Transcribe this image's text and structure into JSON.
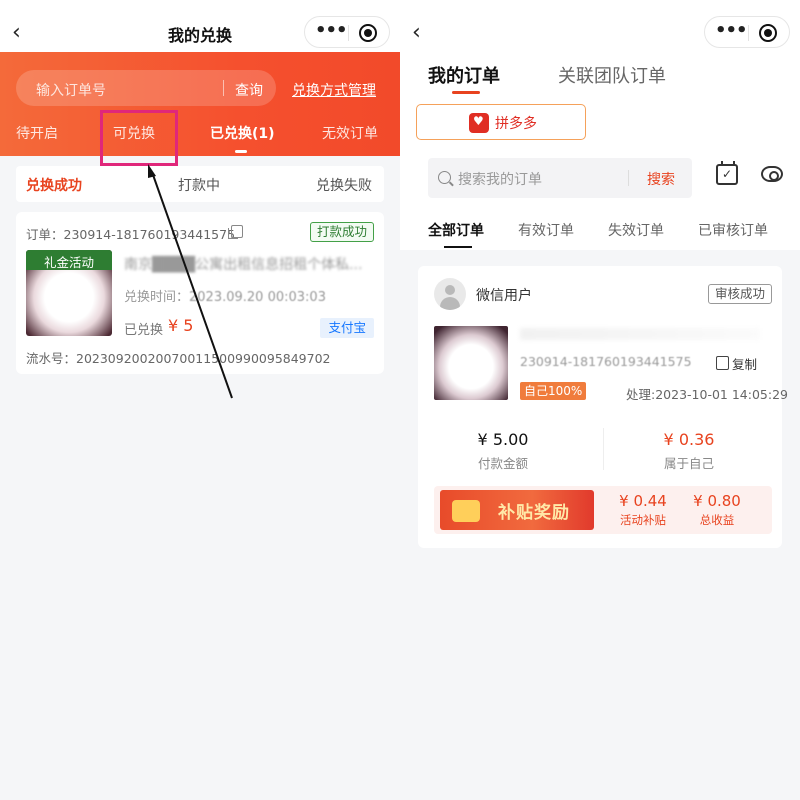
{
  "left": {
    "nav": {
      "back": "‹",
      "title": "我的兑换"
    },
    "search": {
      "placeholder": "输入订单号",
      "button": "查询"
    },
    "manage_link": "兑换方式管理",
    "tabs": [
      "待开启",
      "可兑换",
      "已兑换(1)",
      "无效订单"
    ],
    "active_tab": "已兑换(1)",
    "status_tabs": [
      "兑换成功",
      "打款中",
      "兑换失败"
    ],
    "order": {
      "order_no": "订单：230914-181760193441575",
      "status": "打款成功",
      "thumb_label": "礼金活动",
      "title_blurred": "南京████公寓出租信息招租个体私...",
      "time_label": "兑换时间：",
      "time": "2023.09.20 00:03:03",
      "redeemed_label": "已兑换",
      "amount": "¥ 5",
      "method": "支付宝",
      "serial": "流水号：20230920020070011500990095849702"
    }
  },
  "right": {
    "nav": {
      "back": "‹"
    },
    "tabs": [
      "我的订单",
      "关联团队订单"
    ],
    "platform": "拼多多",
    "search": {
      "placeholder": "搜索我的订单",
      "button": "搜索"
    },
    "filter_tabs": [
      "全部订单",
      "有效订单",
      "失效订单",
      "已审核订单"
    ],
    "order": {
      "user": "微信用户",
      "status": "审核成功",
      "order_no": "230914-181760193441575",
      "copy": "复制",
      "self_badge": "自己100%",
      "process_time": "处理:2023-10-01 14:05:29",
      "pay_amount": "¥ 5.00",
      "pay_label": "付款金额",
      "own_amount": "¥ 0.36",
      "own_label": "属于自己",
      "banner_text": "补贴奖励",
      "activity_amount": "¥ 0.44",
      "activity_label": "活动补贴",
      "total_amount": "¥ 0.80",
      "total_label": "总收益"
    }
  },
  "colors": {
    "accent": "#e8431f",
    "highlight": "#e0277a",
    "success": "#2e7d32",
    "alipay": "#1677ff"
  }
}
